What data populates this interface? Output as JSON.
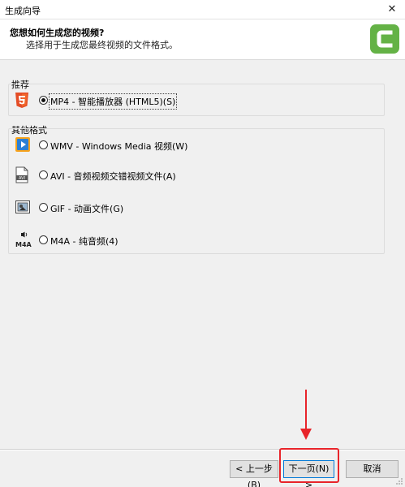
{
  "window": {
    "title": "生成向导",
    "close_glyph": "✕"
  },
  "header": {
    "title": "您想如何生成您的视频?",
    "subtitle": "选择用于生成您最终视频的文件格式。",
    "logo_icon": "camtasia-logo-icon",
    "logo_color": "#64b246"
  },
  "recommended": {
    "label": "推荐",
    "options": [
      {
        "label": "MP4 - 智能播放器 (HTML5)(S)",
        "icon": "html5-icon",
        "checked": true
      }
    ]
  },
  "other": {
    "label": "其他格式",
    "options": [
      {
        "label": "WMV - Windows Media 视频(W)",
        "icon": "windows-media-icon",
        "checked": false
      },
      {
        "label": "AVI - 音频视频交错视频文件(A)",
        "icon": "avi-file-icon",
        "checked": false
      },
      {
        "label": "GIF - 动画文件(G)",
        "icon": "gif-file-icon",
        "checked": false
      },
      {
        "label": "M4A - 纯音频(4)",
        "icon": "m4a-audio-icon",
        "checked": false
      }
    ]
  },
  "footer": {
    "back_label": "< 上一步(B)",
    "next_label": "下一页(N) >",
    "cancel_label": "取消"
  },
  "colors": {
    "highlight": "#e8242a",
    "accent": "#0078d7"
  }
}
